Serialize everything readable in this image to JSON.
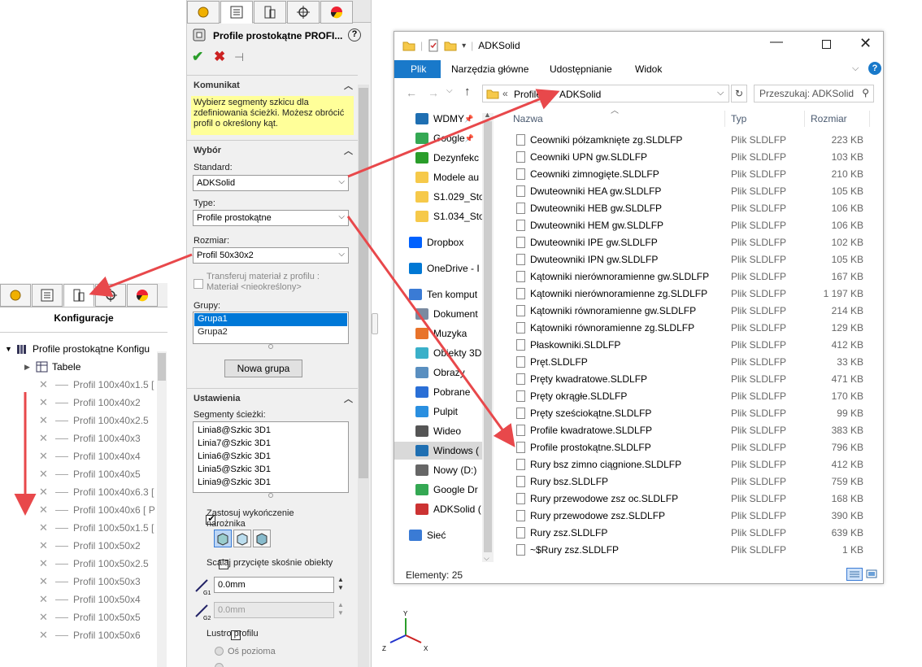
{
  "config_panel": {
    "title": "Konfiguracje",
    "root": "Profile prostokątne Konfigu",
    "tables": "Tabele",
    "items": [
      "Profil 100x40x1.5 [",
      "Profil 100x40x2",
      "Profil 100x40x2.5",
      "Profil 100x40x3",
      "Profil 100x40x4",
      "Profil 100x40x5",
      "Profil 100x40x6.3 [",
      "Profil 100x40x6 [ P",
      "Profil 100x50x1.5 [",
      "Profil 100x50x2",
      "Profil 100x50x2.5",
      "Profil 100x50x3",
      "Profil 100x50x4",
      "Profil 100x50x5",
      "Profil 100x50x6"
    ]
  },
  "property_manager": {
    "title": "Profile prostokątne PROFI...",
    "message_header": "Komunikat",
    "message": "Wybierz segmenty szkicu dla zdefiniowania ścieżki. Możesz obrócić profil o określony kąt.",
    "selection_header": "Wybór",
    "standard_label": "Standard:",
    "standard_value": "ADKSolid",
    "type_label": "Type:",
    "type_value": "Profile prostokątne",
    "size_label": "Rozmiar:",
    "size_value": "Profil 50x30x2",
    "transfer_label": "Transferuj materiał z profilu :",
    "material_label": "Materiał <nieokreślony>",
    "groups_label": "Grupy:",
    "groups": [
      "Grupa1",
      "Grupa2"
    ],
    "new_group_button": "Nowa grupa",
    "settings_header": "Ustawienia",
    "segments_label": "Segmenty ścieżki:",
    "segments": [
      "Linia8@Szkic 3D1",
      "Linia7@Szkic 3D1",
      "Linia6@Szkic 3D1",
      "Linia5@Szkic 3D1",
      "Linia9@Szkic 3D1"
    ],
    "corner_label": "Zastosuj wykończenie narożnika",
    "merge_label": "Scalaj przycięte skośnie obiekty",
    "g1_value": "0.0mm",
    "g2_value": "0.0mm",
    "mirror_label": "Lustro profilu",
    "horizontal_axis": "Oś pozioma"
  },
  "explorer": {
    "window_title": "ADKSolid",
    "ribbon_tabs": [
      "Plik",
      "Narzędzia główne",
      "Udostępnianie",
      "Widok"
    ],
    "path_parent": "Profile",
    "path_current": "ADKSolid",
    "search_placeholder": "Przeszukaj: ADKSolid",
    "nav_items": [
      "WDMY",
      "Google",
      "Dezynfekc",
      "Modele au",
      "S1.029_Sto",
      "S1.034_Sto",
      "Dropbox",
      "OneDrive - I",
      "Ten komput",
      "Dokument",
      "Muzyka",
      "Obiekty 3D",
      "Obrazy",
      "Pobrane",
      "Pulpit",
      "Wideo",
      "Windows (",
      "Nowy (D:)",
      "Google Dr",
      "ADKSolid (",
      "Sieć"
    ],
    "columns": {
      "name": "Nazwa",
      "type": "Typ",
      "size": "Rozmiar"
    },
    "files": [
      {
        "name": "Ceowniki półzamknięte zg.SLDLFP",
        "type": "Plik SLDLFP",
        "size": "223 KB"
      },
      {
        "name": "Ceowniki UPN gw.SLDLFP",
        "type": "Plik SLDLFP",
        "size": "103 KB"
      },
      {
        "name": "Ceowniki zimnogięte.SLDLFP",
        "type": "Plik SLDLFP",
        "size": "210 KB"
      },
      {
        "name": "Dwuteowniki HEA gw.SLDLFP",
        "type": "Plik SLDLFP",
        "size": "105 KB"
      },
      {
        "name": "Dwuteowniki HEB gw.SLDLFP",
        "type": "Plik SLDLFP",
        "size": "106 KB"
      },
      {
        "name": "Dwuteowniki HEM gw.SLDLFP",
        "type": "Plik SLDLFP",
        "size": "106 KB"
      },
      {
        "name": "Dwuteowniki IPE gw.SLDLFP",
        "type": "Plik SLDLFP",
        "size": "102 KB"
      },
      {
        "name": "Dwuteowniki IPN gw.SLDLFP",
        "type": "Plik SLDLFP",
        "size": "105 KB"
      },
      {
        "name": "Kątowniki nierównoramienne gw.SLDLFP",
        "type": "Plik SLDLFP",
        "size": "167 KB"
      },
      {
        "name": "Kątowniki nierównoramienne zg.SLDLFP",
        "type": "Plik SLDLFP",
        "size": "1 197 KB"
      },
      {
        "name": "Kątowniki równoramienne gw.SLDLFP",
        "type": "Plik SLDLFP",
        "size": "214 KB"
      },
      {
        "name": "Kątowniki równoramienne zg.SLDLFP",
        "type": "Plik SLDLFP",
        "size": "129 KB"
      },
      {
        "name": "Płaskowniki.SLDLFP",
        "type": "Plik SLDLFP",
        "size": "412 KB"
      },
      {
        "name": "Pręt.SLDLFP",
        "type": "Plik SLDLFP",
        "size": "33 KB"
      },
      {
        "name": "Pręty kwadratowe.SLDLFP",
        "type": "Plik SLDLFP",
        "size": "471 KB"
      },
      {
        "name": "Pręty okrągłe.SLDLFP",
        "type": "Plik SLDLFP",
        "size": "170 KB"
      },
      {
        "name": "Pręty sześciokątne.SLDLFP",
        "type": "Plik SLDLFP",
        "size": "99 KB"
      },
      {
        "name": "Profile kwadratowe.SLDLFP",
        "type": "Plik SLDLFP",
        "size": "383 KB"
      },
      {
        "name": "Profile prostokątne.SLDLFP",
        "type": "Plik SLDLFP",
        "size": "796 KB"
      },
      {
        "name": "Rury bsz zimno ciągnione.SLDLFP",
        "type": "Plik SLDLFP",
        "size": "412 KB"
      },
      {
        "name": "Rury bsz.SLDLFP",
        "type": "Plik SLDLFP",
        "size": "759 KB"
      },
      {
        "name": "Rury przewodowe zsz oc.SLDLFP",
        "type": "Plik SLDLFP",
        "size": "168 KB"
      },
      {
        "name": "Rury przewodowe zsz.SLDLFP",
        "type": "Plik SLDLFP",
        "size": "390 KB"
      },
      {
        "name": "Rury zsz.SLDLFP",
        "type": "Plik SLDLFP",
        "size": "639 KB"
      },
      {
        "name": "~$Rury zsz.SLDLFP",
        "type": "Plik SLDLFP",
        "size": "1 KB"
      }
    ],
    "status": "Elementy: 25"
  },
  "triad": {
    "y": "Y",
    "z": "Z",
    "x": "X"
  },
  "colors": {
    "accent": "#0078d7",
    "arrow": "#e8484b",
    "message_bg": "#ffff99",
    "ok": "#2a9d2a",
    "cancel": "#cc2222"
  }
}
